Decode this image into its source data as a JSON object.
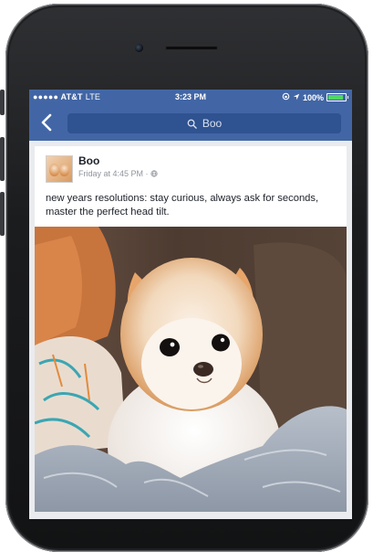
{
  "status_bar": {
    "carrier": "●●●●● AT&T",
    "network": "LTE",
    "time": "3:23 PM",
    "battery_percent": "100%",
    "battery_level": 1.0,
    "icons": [
      "orientation-lock-icon",
      "location-icon",
      "battery-icon"
    ]
  },
  "nav": {
    "back_icon": "back-chevron-icon",
    "search_icon": "search-icon",
    "search_text": "Boo"
  },
  "post": {
    "author": "Boo",
    "meta": "Friday at 4:45 PM ·",
    "privacy_icon": "globe-icon",
    "text": "new years resolutions:  stay curious, always ask for seconds, master the perfect head tilt."
  },
  "colors": {
    "facebook_blue": "#4266a5",
    "search_bg": "#2f5290",
    "feed_bg": "#e9ebee",
    "battery_green": "#4cd964"
  }
}
